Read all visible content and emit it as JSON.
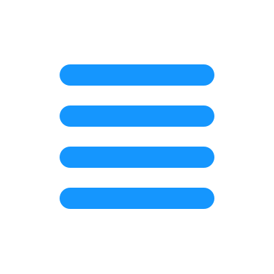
{
  "icon": {
    "name": "hamburger-menu-icon",
    "bar_count": 4,
    "color": "#1596FE",
    "background": "#FFFFFF"
  }
}
